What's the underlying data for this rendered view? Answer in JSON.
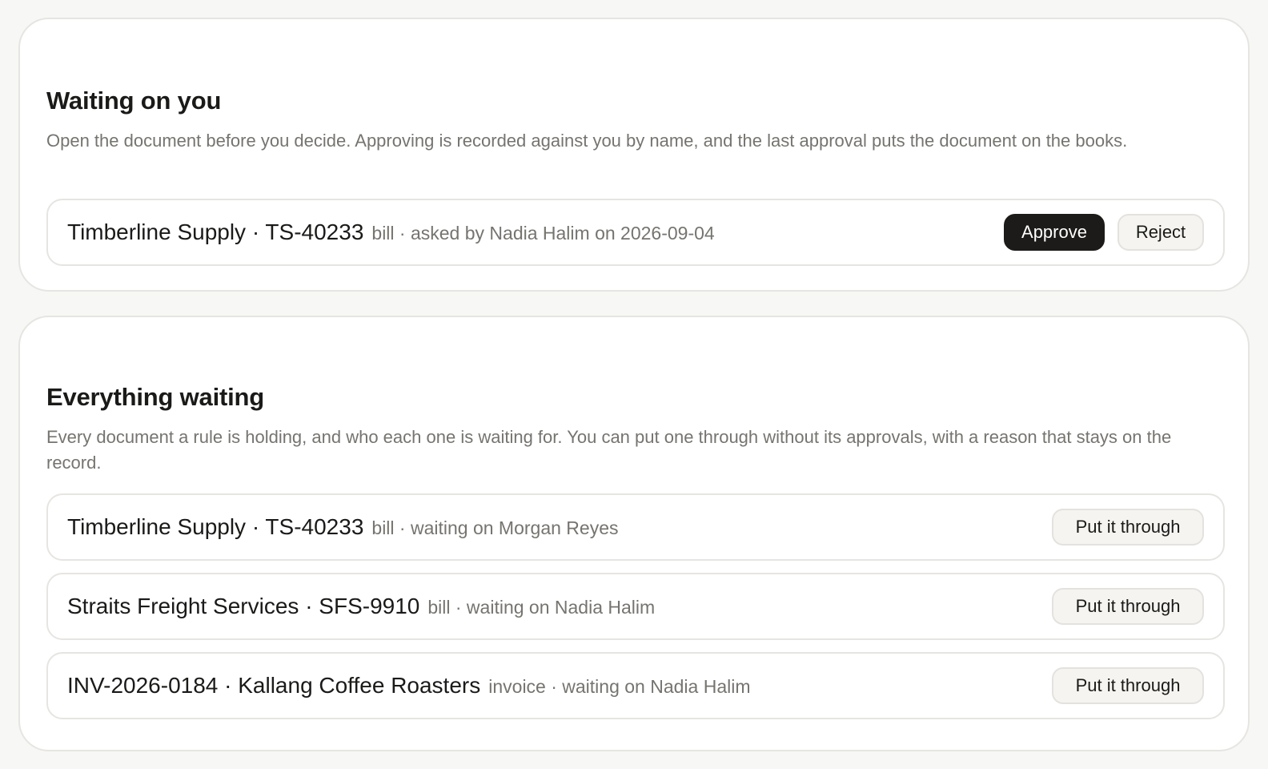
{
  "waiting_on_you": {
    "title": "Waiting on you",
    "description": "Open the document before you decide. Approving is recorded against you by name, and the last approval puts the document on the books.",
    "items": [
      {
        "name": "Timberline Supply · TS-40233",
        "meta": "bill · asked by Nadia Halim on 2026-09-04",
        "approve_label": "Approve",
        "reject_label": "Reject"
      }
    ]
  },
  "everything_waiting": {
    "title": "Everything waiting",
    "description": "Every document a rule is holding, and who each one is waiting for. You can put one through without its approvals, with a reason that stays on the record.",
    "items": [
      {
        "name": "Timberline Supply · TS-40233",
        "meta": "bill · waiting on Morgan Reyes",
        "action_label": "Put it through"
      },
      {
        "name": "Straits Freight Services · SFS-9910",
        "meta": "bill · waiting on Nadia Halim",
        "action_label": "Put it through"
      },
      {
        "name": "INV-2026-0184 · Kallang Coffee Roasters",
        "meta": "invoice · waiting on Nadia Halim",
        "action_label": "Put it through"
      }
    ]
  },
  "colors": {
    "page_background": "#f7f7f5",
    "card_background": "#ffffff",
    "border": "#e6e5e1",
    "text_primary": "#1a1a18",
    "text_muted": "#76746f",
    "primary_button": "#1c1b19",
    "secondary_button": "#f5f4f1"
  }
}
